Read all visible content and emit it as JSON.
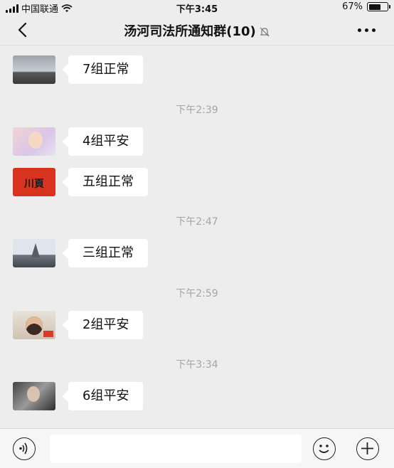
{
  "status_bar": {
    "carrier": "中国联通",
    "time": "下午3:45",
    "battery": "67%",
    "battery_level": 0.67
  },
  "header": {
    "title": "汤河司法所通知群(10)"
  },
  "messages": [
    {
      "text": "7组正常"
    },
    {
      "text": "4组平安"
    },
    {
      "text": "五组正常"
    },
    {
      "text": "三组正常"
    },
    {
      "text": "2组平安"
    },
    {
      "text": "6组平安"
    }
  ],
  "timestamps": [
    "下午2:39",
    "下午2:47",
    "下午2:59",
    "下午3:34"
  ],
  "avatars": {
    "red_avatar_text": "川頁"
  },
  "input": {
    "value": "",
    "placeholder": ""
  },
  "colors": {
    "background": "#ededed",
    "bubble": "#ffffff",
    "timestamp": "#a5a5a5"
  }
}
